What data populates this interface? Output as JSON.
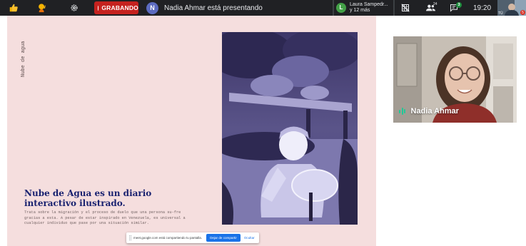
{
  "top_bar": {
    "recording_label": "GRABANDO",
    "presenter_initial": "N",
    "presenter_text": "Nadia Ahmar está presentando",
    "participant_initial": "L",
    "participant_line1": "Laura Sampedr...",
    "participant_line2": "y 12 más",
    "people_count": "24",
    "chat_badge": "3",
    "time": "19:20",
    "self_label": "TÚ",
    "self_badge": "5"
  },
  "slide": {
    "vertical_title": "Nube de agua",
    "headline": "Nube de Agua es un diario interactivo ilustrado.",
    "body": "Trata sobre la migración y el proceso de duelo que una persona su-fre gracias a esta. A pesar de estar inspirado en Venezuela, es universal a cualquier individuo que pase por una situación similar."
  },
  "share_notice": {
    "text": "meet.google.com está compartiendo tu pantalla.",
    "stop_label": "Dejar de compartir",
    "hide_label": "Ocultar"
  },
  "participant_tile": {
    "name": "Nadia Ahmar"
  },
  "colors": {
    "top_bar_bg": "#202124",
    "recording_red": "#c5221f",
    "slide_bg": "#f5dede",
    "headline_blue": "#1a2270",
    "share_button_blue": "#1a73e8",
    "speaking_indicator": "#20c997"
  },
  "icons": {
    "thumbs_up": "thumbs-up-icon",
    "raise_hand": "raise-hand-icon",
    "settings": "gear-icon",
    "no_layout": "grid-off-icon",
    "people": "people-icon",
    "chat": "chat-icon"
  }
}
